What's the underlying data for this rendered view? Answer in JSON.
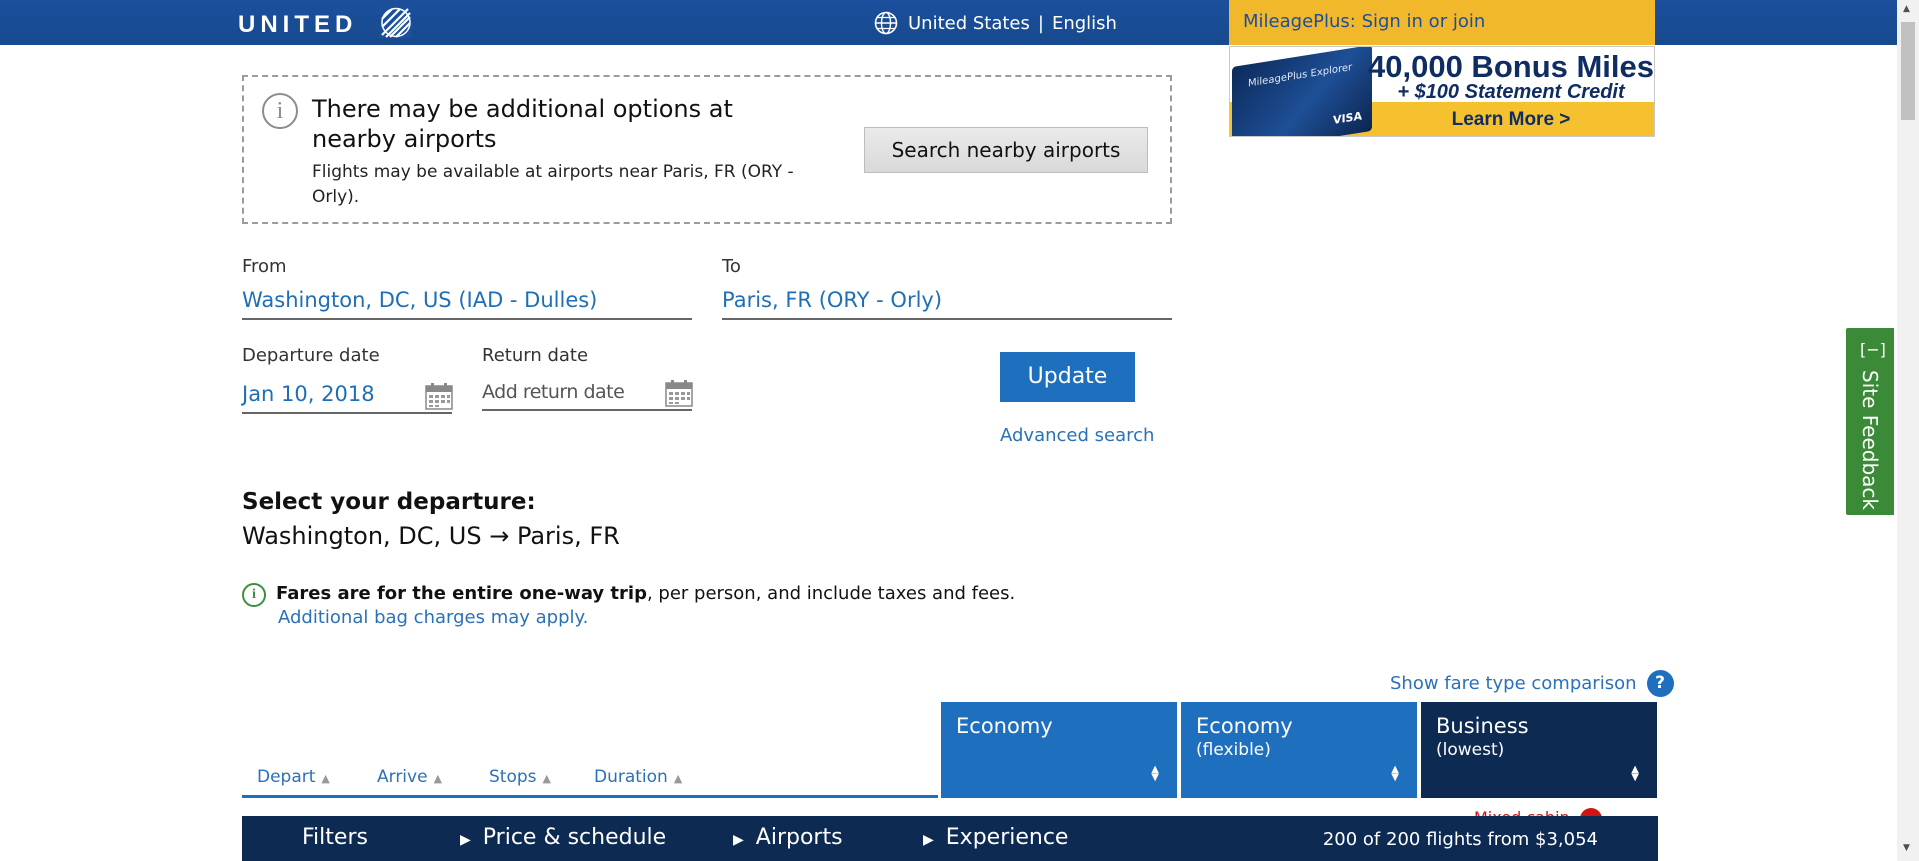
{
  "header": {
    "logo": "UNITED",
    "country": "United States",
    "language": "English",
    "mileageplus": "MileagePlus: Sign in or join"
  },
  "ad": {
    "card_name": "MileagePlus Explorer",
    "card_brand": "VISA",
    "headline": "40,000 Bonus Miles",
    "subline": "+ $100 Statement Credit",
    "cta": "Learn More >"
  },
  "notice": {
    "title": "There may be additional options at nearby airports",
    "text": "Flights may be available at airports near Paris, FR (ORY - Orly).",
    "button": "Search nearby airports"
  },
  "search": {
    "from_label": "From",
    "from_value": "Washington, DC, US (IAD - Dulles)",
    "to_label": "To",
    "to_value": "Paris, FR (ORY - Orly)",
    "departure_label": "Departure date",
    "departure_value": "Jan 10, 2018",
    "return_label": "Return date",
    "return_placeholder": "Add return date",
    "update_button": "Update",
    "advanced_link": "Advanced search"
  },
  "selection": {
    "title": "Select your departure:",
    "route": "Washington, DC, US → Paris, FR",
    "fare_bold": "Fares are for the entire one-way trip",
    "fare_rest": ", per person, and include taxes and fees.",
    "bag_link": "Additional bag charges may apply."
  },
  "results": {
    "compare_link": "Show fare type comparison",
    "sort": [
      "Depart",
      "Arrive",
      "Stops",
      "Duration"
    ],
    "fare_columns": [
      {
        "title": "Economy",
        "subtitle": ""
      },
      {
        "title": "Economy",
        "subtitle": "(flexible)"
      },
      {
        "title": "Business",
        "subtitle": "(lowest)"
      }
    ],
    "partial_text": "Mixed cabin"
  },
  "filters": {
    "label": "Filters",
    "items": [
      "Price & schedule",
      "Airports",
      "Experience"
    ],
    "count": "200 of 200 flights from $3,054"
  },
  "feedback": {
    "minimize": "[−]",
    "label": "Site Feedback"
  },
  "colors": {
    "brand_blue": "#1b4f9c",
    "mileageplus_gold": "#f2b82b",
    "economy_blue": "#1f6fbf",
    "business_navy": "#0c2a52",
    "feedback_green": "#3a8a38"
  }
}
